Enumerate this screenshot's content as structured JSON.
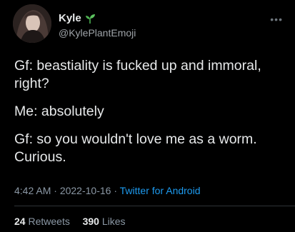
{
  "author": {
    "display_name": "Kyle",
    "handle": "@KylePlantEmoji",
    "name_icon": "seedling-icon"
  },
  "tweet": {
    "lines": [
      "Gf: beastiality is fucked up and immoral, right?",
      "Me: absolutely",
      "Gf: so you wouldn't love me as a worm. Curious."
    ],
    "time": "4:42 AM",
    "date": "2022-10-16",
    "separator": "·",
    "source": "Twitter for Android"
  },
  "stats": {
    "retweets_count": "24",
    "retweets_label": "Retweets",
    "likes_count": "390",
    "likes_label": "Likes"
  },
  "colors": {
    "background": "#000000",
    "text": "#e7e9ea",
    "muted": "#8b98a5",
    "link": "#1d9bf0",
    "plant": "#4caf50"
  }
}
